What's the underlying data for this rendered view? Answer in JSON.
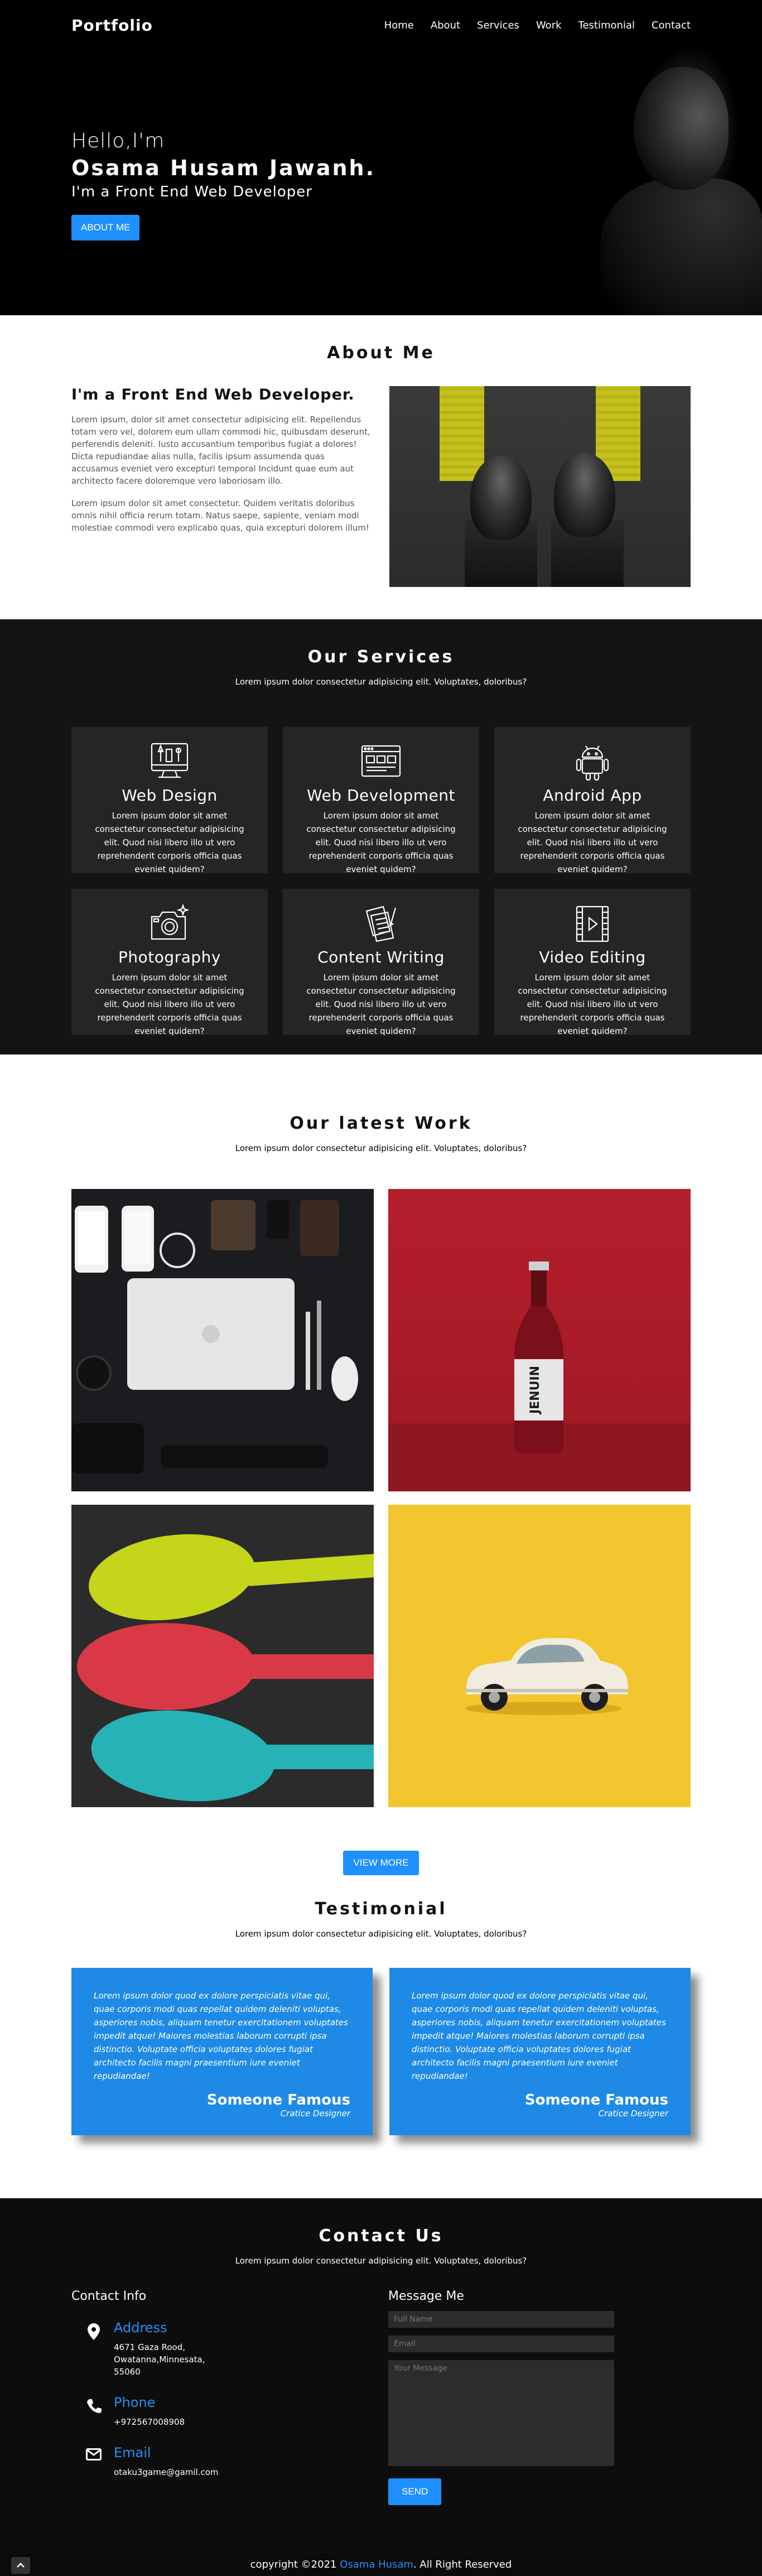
{
  "nav": {
    "logo": "Portfolio",
    "links": [
      "Home",
      "About",
      "Services",
      "Work",
      "Testimonial",
      "Contact"
    ]
  },
  "hero": {
    "hello": "Hello,I'm",
    "name": "Osama Husam Jawanh.",
    "role": "I'm a Front End Web Developer",
    "button": "ABOUT ME"
  },
  "about": {
    "title": "About Me",
    "heading": "I'm a Front End Web Developer.",
    "p1": "Lorem ipsum, dolor sit amet consectetur adipisicing elit. Repellendus totam vero vel, dolorem eum ullam commodi hic, quibusdam deserunt, perferendis deleniti. Iusto accusantium temporibus fugiat a dolores! Dicta repudiandae alias nulla, facilis ipsum assumenda quas accusamus eveniet vero excepturi temporal Incidunt quae eum aut architecto facere doloremque vero laboriosam illo.",
    "p2": "Lorem ipsum dolor sit amet consectetur. Quidem veritatis doloribus omnis nihil officia rerum totam. Natus saepe, sapiente, veniam modi molestiae commodi vero explicabo quas, quia excepturi dolorem illum!"
  },
  "services": {
    "title": "Our Services",
    "subtitle": "Lorem ipsum dolor consectetur adipisicing elit. Voluptates, doloribus?",
    "items": [
      {
        "title": "Web Design",
        "icon": "web-design-icon",
        "text": "Lorem ipsum dolor sit amet consectetur consectetur adipisicing elit. Quod nisi libero illo ut vero reprehenderit corporis officia quas eveniet quidem?"
      },
      {
        "title": "Web Development",
        "icon": "web-development-icon",
        "text": "Lorem ipsum dolor sit amet consectetur consectetur adipisicing elit. Quod nisi libero illo ut vero reprehenderit corporis officia quas eveniet quidem?"
      },
      {
        "title": "Android App",
        "icon": "android-icon",
        "text": "Lorem ipsum dolor sit amet consectetur consectetur adipisicing elit. Quod nisi libero illo ut vero reprehenderit corporis officia quas eveniet quidem?"
      },
      {
        "title": "Photography",
        "icon": "camera-icon",
        "text": "Lorem ipsum dolor sit amet consectetur consectetur adipisicing elit. Quod nisi libero illo ut vero reprehenderit corporis officia quas eveniet quidem?"
      },
      {
        "title": "Content Writing",
        "icon": "content-writing-icon",
        "text": "Lorem ipsum dolor sit amet consectetur consectetur adipisicing elit. Quod nisi libero illo ut vero reprehenderit corporis officia quas eveniet quidem?"
      },
      {
        "title": "Video Editing",
        "icon": "video-editing-icon",
        "text": "Lorem ipsum dolor sit amet consectetur consectetur adipisicing elit. Quod nisi libero illo ut vero reprehenderit corporis officia quas eveniet quidem?"
      }
    ]
  },
  "work": {
    "title": "Our latest Work",
    "subtitle": "Lorem ipsum dolor consectetur adipisicing elit. Voluptates, doloribus?",
    "bottle_label": "JENUIN",
    "button": "VIEW MORE"
  },
  "testimonial": {
    "title": "Testimonial",
    "subtitle": "Lorem ipsum dolor consectetur adipisicing elit. Voluptates, doloribus?",
    "items": [
      {
        "quote": "Lorem ipsum dolor quod ex dolore perspiciatis vitae qui, quae corporis modi quas repellat quidem deleniti voluptas, asperiores nobis, aliquam tenetur exercitationem voluptates impedit atque! Maiores molestias laborum corrupti ipsa distinctio. Voluptate officia voluptates dolores fugiat architecto facilis magni praesentium iure eveniet repudiandae!",
        "name": "Someone Famous",
        "job": "Cratice Designer"
      },
      {
        "quote": "Lorem ipsum dolor quod ex dolore perspiciatis vitae qui, quae corporis modi quas repellat quidem deleniti voluptas, asperiores nobis, aliquam tenetur exercitationem voluptates impedit atque! Maiores molestias laborum corrupti ipsa distinctio. Voluptate officia voluptates dolores fugiat architecto facilis magni praesentium iure eveniet repudiandae!",
        "name": "Someone Famous",
        "job": "Cratice Designer"
      }
    ]
  },
  "contact": {
    "title": "Contact Us",
    "subtitle": "Lorem ipsum dolor consectetur adipisicing elit. Voluptates, doloribus?",
    "info_heading": "Contact Info",
    "address_label": "Address",
    "address": "4671 Gaza Rood, Owatanna,Minnesata, 55060",
    "phone_label": "Phone",
    "phone": "+972567008908",
    "email_label": "Email",
    "email": "otaku3game@gamil.com",
    "message_heading": "Message Me",
    "name_placeholder": "Full Name",
    "email_placeholder": "Email",
    "message_placeholder": "Your Message",
    "send": "SEND"
  },
  "footer": {
    "prefix": "copyright ©2021 ",
    "link": "Osama Husam",
    "suffix": ". All Right Reserved"
  },
  "colors": {
    "accent": "#1e90ff",
    "dark": "#141414",
    "card": "#252525"
  }
}
